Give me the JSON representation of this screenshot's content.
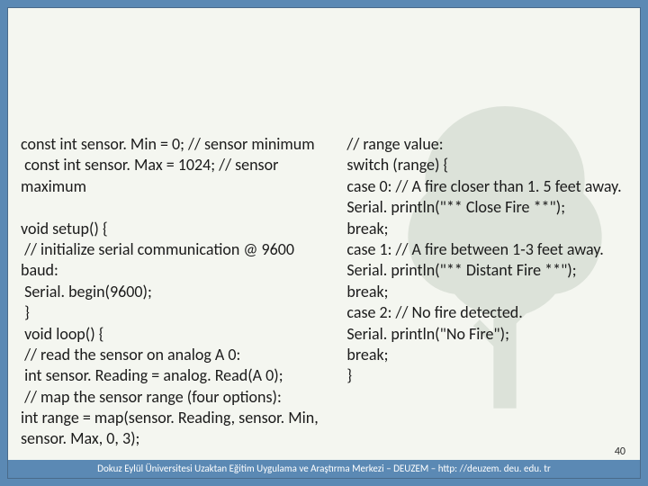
{
  "slide": {
    "left_code": "const int sensor. Min = 0; // sensor minimum\n const int sensor. Max = 1024; // sensor maximum\n\nvoid setup() {\n // initialize serial communication @ 9600 baud:\n Serial. begin(9600);\n }\n void loop() {\n // read the sensor on analog A 0:\n int sensor. Reading = analog. Read(A 0);\n // map the sensor range (four options):\nint range = map(sensor. Reading, sensor. Min, sensor. Max, 0, 3);",
    "right_code": " // range value:\n switch (range) {\n case 0: // A fire closer than 1. 5 feet away.\n Serial. println(\"** Close Fire **\");\n break;\n case 1: // A fire between 1-3 feet away.\n Serial. println(\"** Distant Fire **\");\n break;\n case 2: // No fire detected.\n Serial. println(\"No Fire\");\n break;\n }",
    "page_number": "40",
    "footer_text": "Dokuz Eylül Üniversitesi Uzaktan Eğitim Uygulama ve Araştırma Merkezi – DEUZEM – http: //deuzem. deu. edu. tr"
  }
}
